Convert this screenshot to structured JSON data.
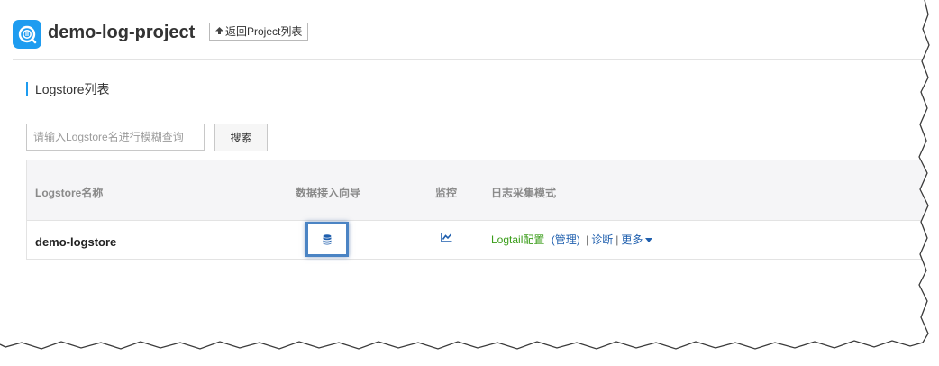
{
  "header": {
    "project_name": "demo-log-project",
    "back_label": "返回Project列表",
    "logo_icon": "log-search-icon",
    "back_icon": "upload-arrow-icon"
  },
  "section": {
    "title": "Logstore列表"
  },
  "search": {
    "placeholder": "请输入Logstore名进行模糊查询",
    "value": "",
    "button_label": "搜索"
  },
  "table": {
    "columns": [
      "Logstore名称",
      "数据接入向导",
      "监控",
      "日志采集模式"
    ],
    "rows": [
      {
        "name": "demo-logstore",
        "wizard_icon": "database-icon",
        "monitor_icon": "line-chart-icon",
        "logtail_config": "Logtail配置",
        "manage": "(管理)",
        "diagnose": "诊断",
        "more": "更多"
      }
    ]
  },
  "colors": {
    "accent": "#1e9cf0",
    "link_blue": "#1f5fae",
    "link_green": "#3b9d1a",
    "highlight_border": "#4b84c4"
  }
}
